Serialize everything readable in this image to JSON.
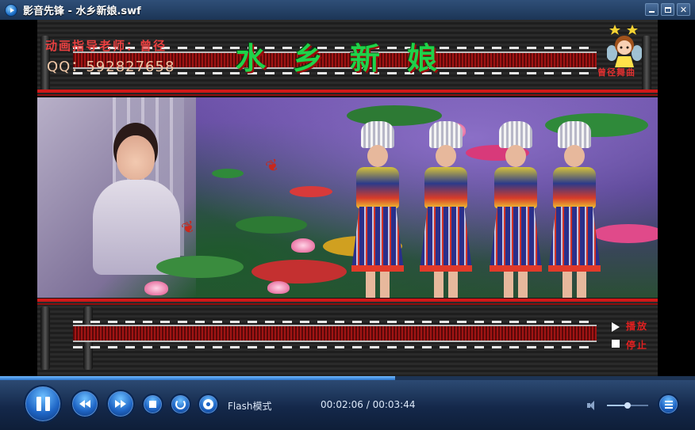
{
  "window": {
    "title": "影音先锋 - 水乡新娘.swf"
  },
  "video": {
    "credit_line": "动画指导老师：曾径",
    "qq_line": "QQ：592827658",
    "song_title": "水乡新娘",
    "fairy_caption": "曾径舞曲",
    "side_controls": {
      "play_label": "播放",
      "stop_label": "停止"
    }
  },
  "playback": {
    "progress_fraction": 0.569,
    "mode": "Flash模式",
    "time": "00:02:06 / 00:03:44",
    "volume_fraction": 0.5
  },
  "colors": {
    "accent": "#2b74c9",
    "title_bar": "#1c3556"
  },
  "icons": {
    "app": "play-circle-icon",
    "pause": "pause-icon",
    "prev": "rewind-icon",
    "next": "fast-forward-icon",
    "stop": "stop-icon",
    "loop": "loop-icon",
    "disc": "disc-icon",
    "volume": "speaker-icon",
    "playlist": "playlist-icon"
  }
}
